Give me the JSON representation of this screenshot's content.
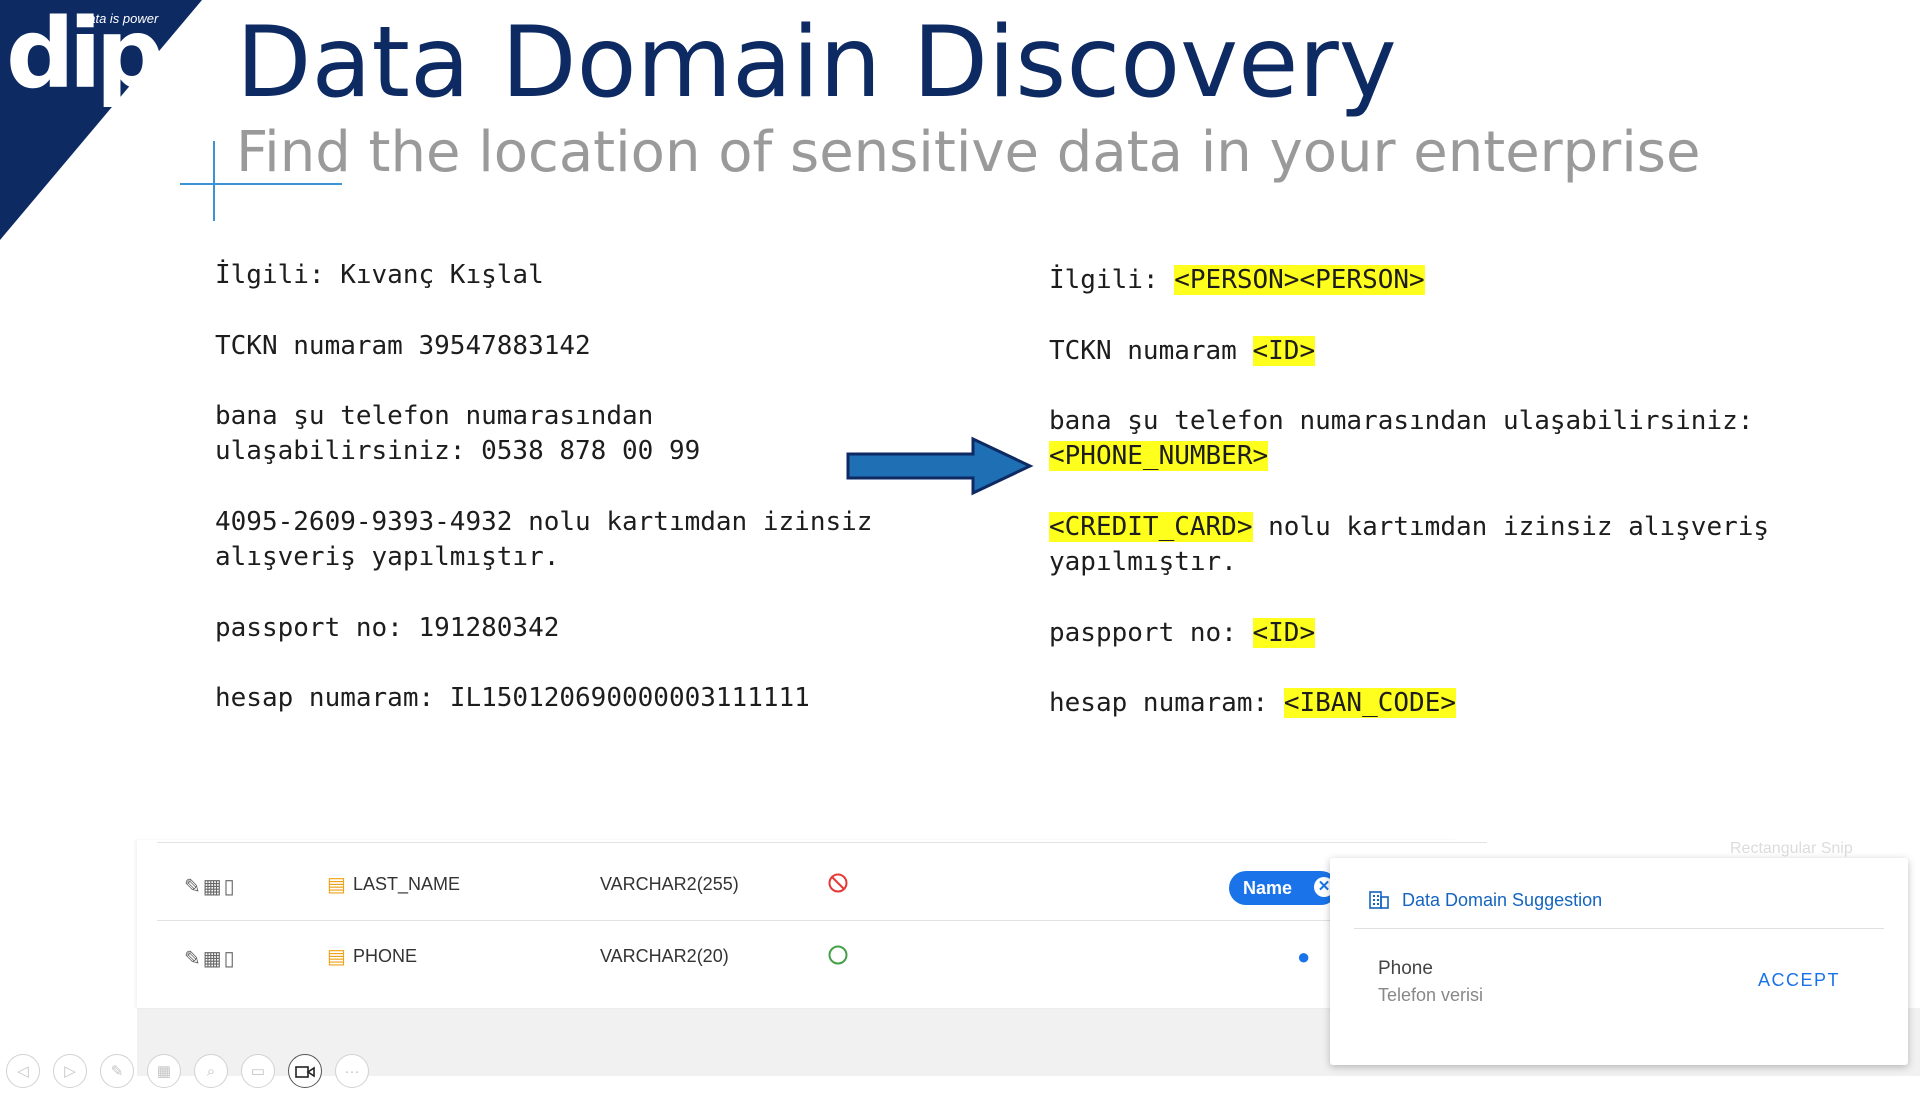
{
  "logo": {
    "mark": "dip",
    "tagline": "data is power"
  },
  "header": {
    "title": "Data Domain Discovery",
    "subtitle": "Find the location of sensitive data in your enterprise"
  },
  "original_text": [
    "İlgili: Kıvanç Kışlal",
    "TCKN numaram 39547883142",
    "bana şu telefon numarasından",
    "ulaşabilirsiniz: 0538 878 00 99",
    "4095-2609-9393-4932 nolu kartımdan izinsiz",
    "alışveriş yapılmıştır.",
    "passport no: 191280342",
    "hesap numaram: IL150120690000003111111"
  ],
  "masked_text": {
    "l1_prefix": "İlgili: ",
    "l1_tag": "<PERSON><PERSON>",
    "l2_prefix": "TCKN numaram ",
    "l2_tag": "<ID>",
    "l3_text": "bana şu telefon numarasından ulaşabilirsiniz:",
    "l4_tag": "<PHONE_NUMBER>",
    "l5_tag": "<CREDIT_CARD>",
    "l5_suffix": " nolu kartımdan izinsiz alışveriş",
    "l6_text": "yapılmıştır.",
    "l7_prefix": "paspport no: ",
    "l7_tag": "<ID>",
    "l8_prefix": "hesap numaram: ",
    "l8_tag": "<IBAN_CODE>"
  },
  "table": {
    "rows": [
      {
        "column": "LAST_NAME",
        "type": "VARCHAR2(255)",
        "status": "blocked",
        "chip": "Name"
      },
      {
        "column": "PHONE",
        "type": "VARCHAR2(20)",
        "status": "ok"
      }
    ]
  },
  "popup": {
    "faded_label": "Rectangular Snip",
    "heading": "Data Domain Suggestion",
    "suggestion_name": "Phone",
    "suggestion_desc": "Telefon verisi",
    "accept_label": "ACCEPT"
  },
  "colors": {
    "brand_navy": "#0d2a63",
    "highlight": "#ffff1e",
    "arrow_blue": "#1f6fb5",
    "accent_blue": "#1a73e8",
    "blocked_red": "#e53935",
    "ok_green": "#43a047",
    "field_orange": "#f0a21b"
  },
  "icons": [
    "pencil-icon",
    "building-icon",
    "book-icon",
    "field-icon",
    "blocked-icon",
    "ok-circle-icon",
    "close-icon",
    "lightbulb-icon",
    "domain-icon"
  ]
}
